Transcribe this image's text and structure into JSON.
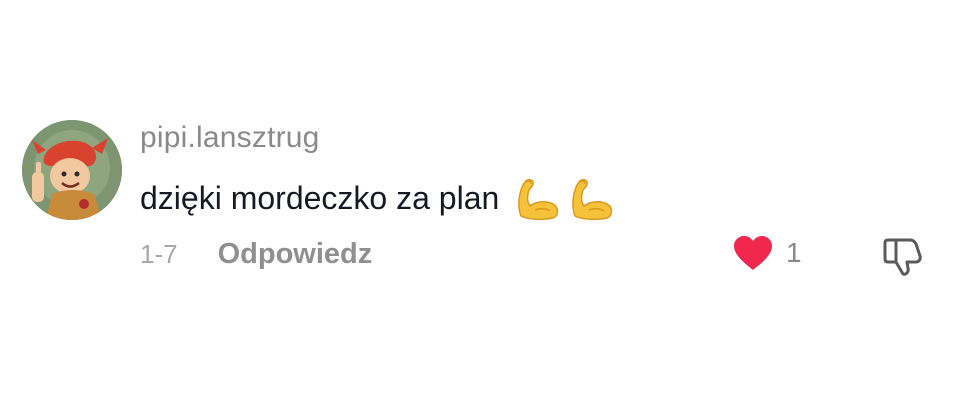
{
  "comment": {
    "username": "pipi.lansztrug",
    "text": "dzięki mordeczko za plan",
    "emojis": [
      "muscle-icon",
      "muscle-icon"
    ],
    "date": "1-7",
    "reply_label": "Odpowiedz",
    "like_count": "1",
    "liked": true
  },
  "icons": {
    "like": "heart-icon",
    "dislike": "thumbs-down-icon",
    "avatar": "avatar-image"
  },
  "colors": {
    "heart": "#f0284f",
    "username": "#8a8a8a",
    "text": "#161823",
    "muscle": "#f6c13b"
  }
}
